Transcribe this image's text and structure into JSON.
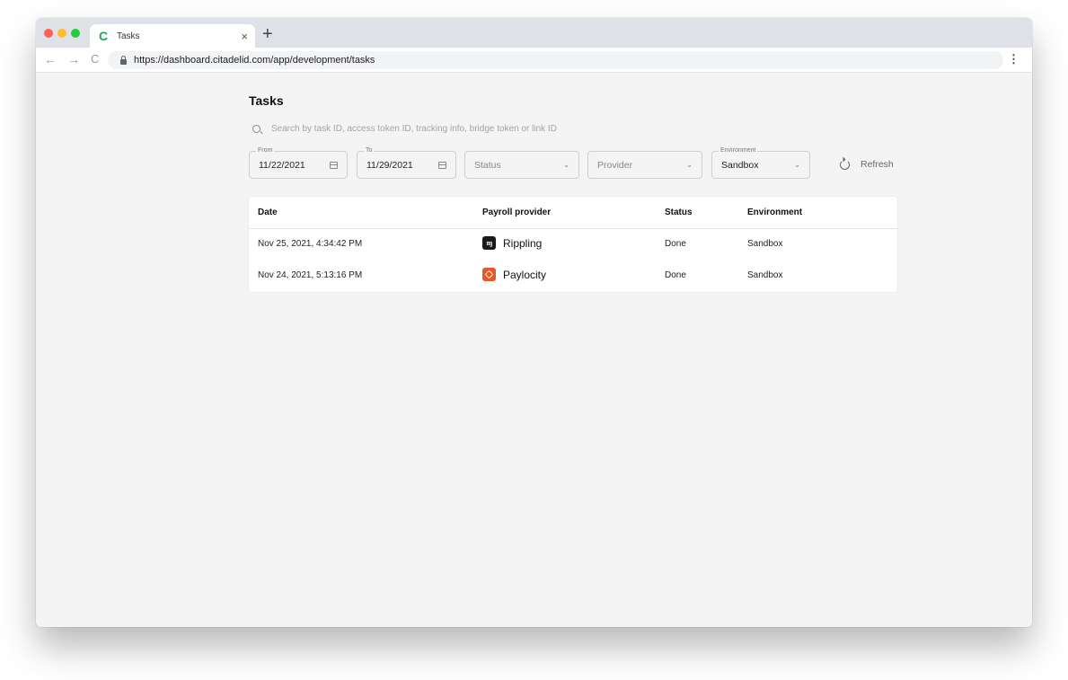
{
  "browser": {
    "tab_title": "Tasks",
    "tab_favicon": "C",
    "tab_close": "×",
    "new_tab": "+",
    "url": "https://dashboard.citadelid.com/app/development/tasks",
    "nav_back": "←",
    "nav_forward": "→",
    "nav_reload": "C",
    "menu": "⋮"
  },
  "page": {
    "title": "Tasks"
  },
  "search": {
    "placeholder": "Search by task ID, access token ID, tracking info, bridge token or link ID"
  },
  "filters": {
    "from": {
      "label": "From",
      "value": "11/22/2021"
    },
    "to": {
      "label": "To",
      "value": "11/29/2021"
    },
    "status": {
      "placeholder": "Status"
    },
    "provider": {
      "placeholder": "Provider"
    },
    "environment": {
      "label": "Environment",
      "value": "Sandbox"
    },
    "chevron": "⌄",
    "refresh_label": "Refresh"
  },
  "table": {
    "headers": [
      "Date",
      "Payroll provider",
      "Status",
      "Environment"
    ],
    "rows": [
      {
        "date": "Nov 25, 2021, 4:34:42 PM",
        "provider": "Rippling",
        "provider_logo": "ɱ",
        "status": "Done",
        "environment": "Sandbox"
      },
      {
        "date": "Nov 24, 2021, 5:13:16 PM",
        "provider": "Paylocity",
        "provider_logo": "",
        "status": "Done",
        "environment": "Sandbox"
      }
    ]
  },
  "colors": {
    "brand_green": "#1fa55a",
    "rippling": "#1a1a1a",
    "paylocity": "#e8562a"
  }
}
